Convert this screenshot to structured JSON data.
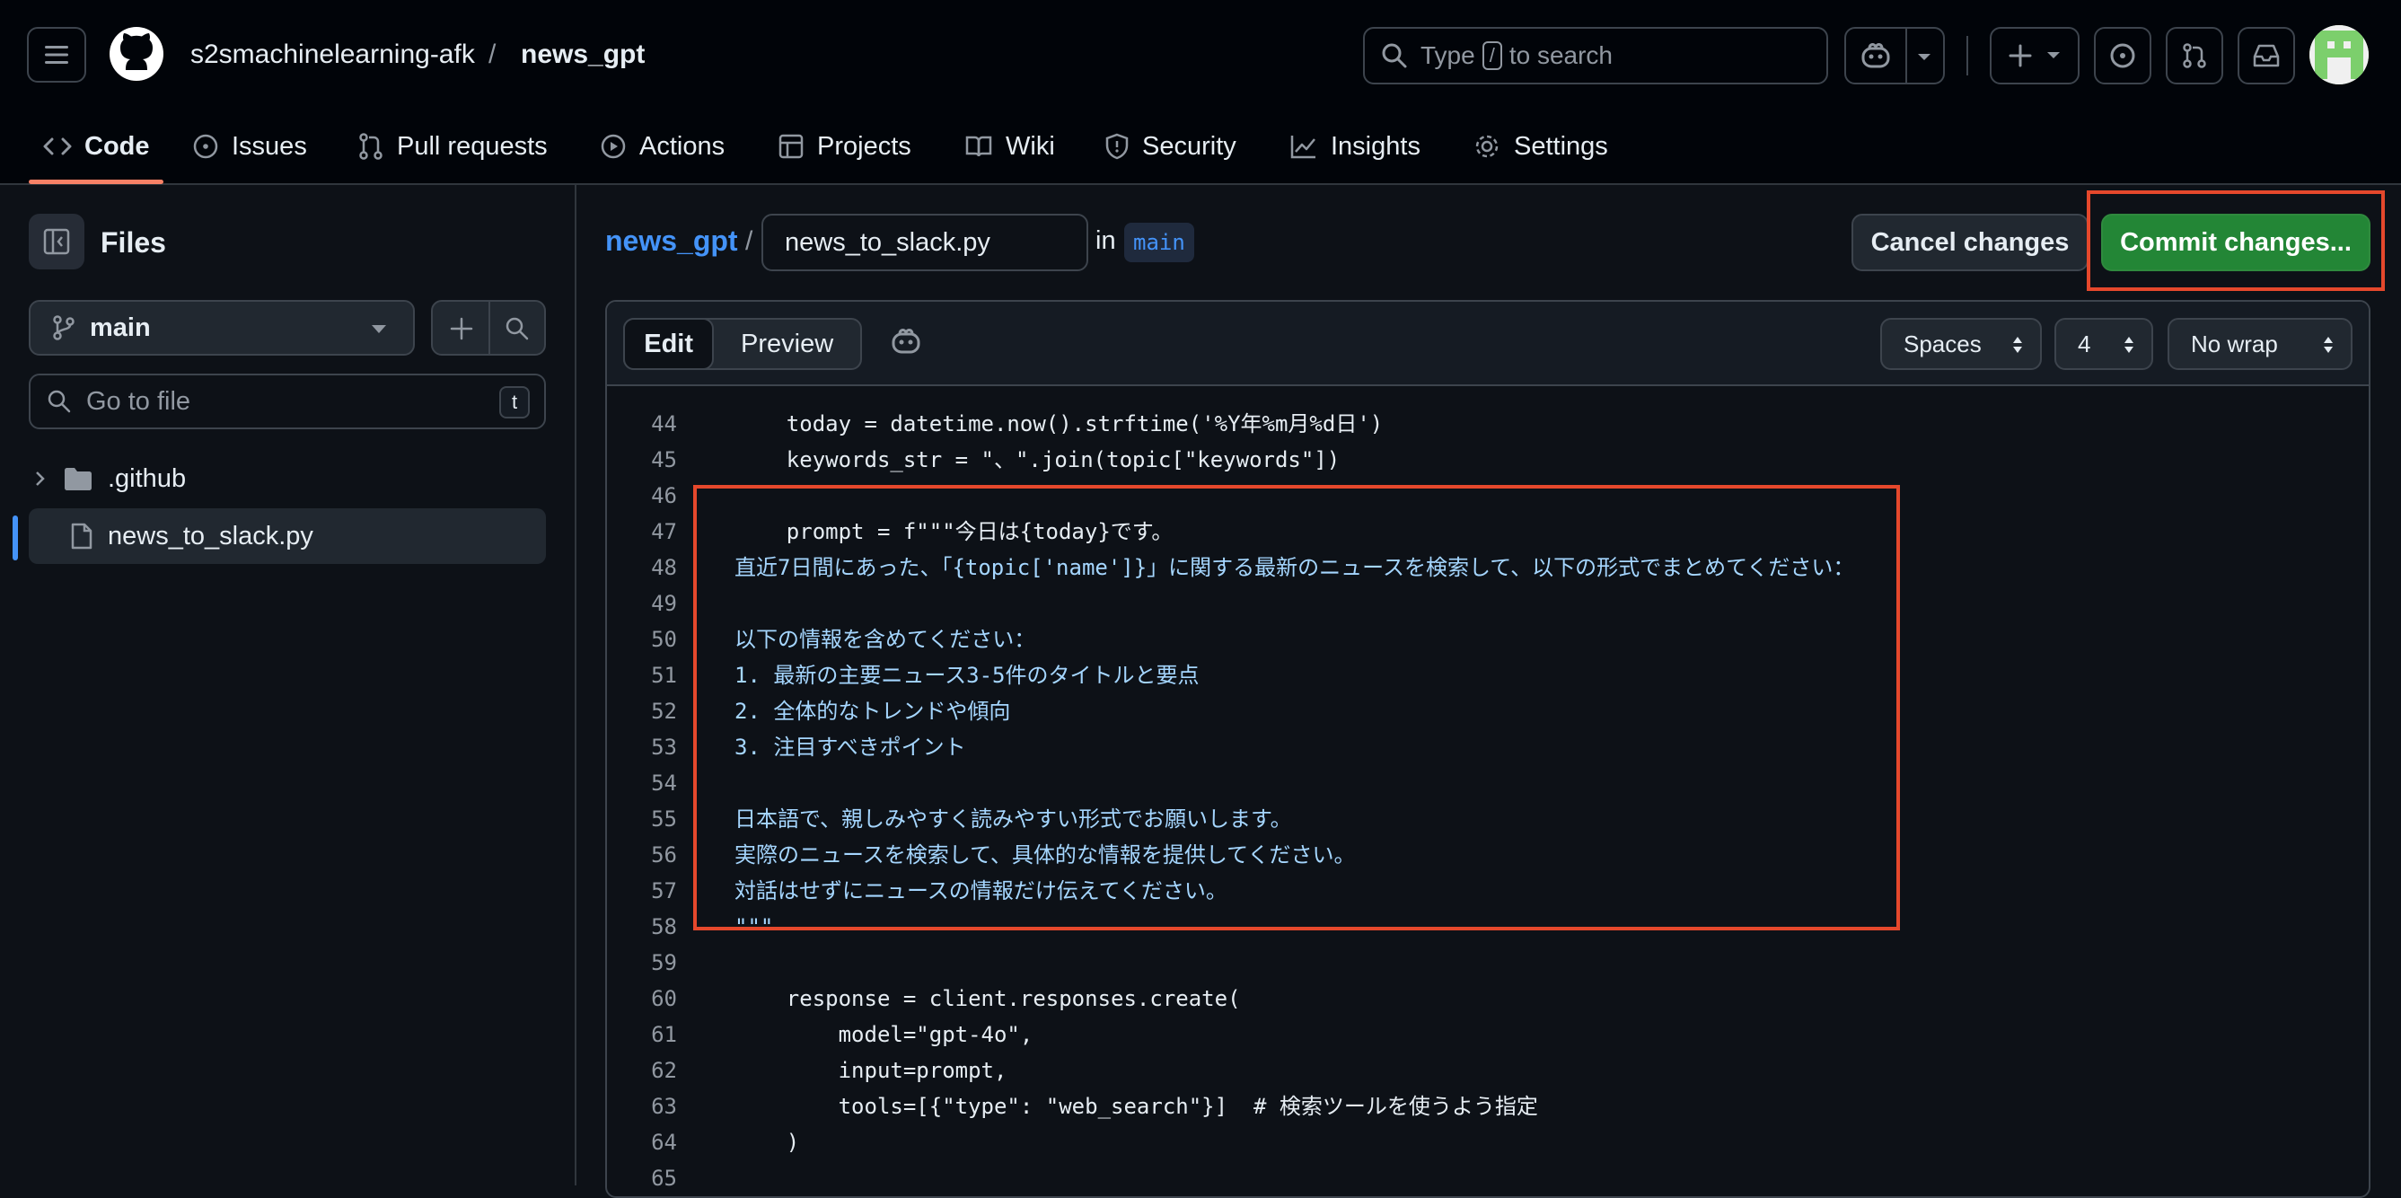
{
  "header": {
    "owner": "s2smachinelearning-afk",
    "slash": "/",
    "repo": "news_gpt",
    "search": {
      "prefix": "Type",
      "key": "/",
      "suffix": "to search"
    }
  },
  "nav": {
    "code": "Code",
    "issues": "Issues",
    "pull_requests": "Pull requests",
    "actions": "Actions",
    "projects": "Projects",
    "wiki": "Wiki",
    "security": "Security",
    "insights": "Insights",
    "settings": "Settings"
  },
  "sidebar": {
    "title": "Files",
    "branch": "main",
    "goto_placeholder": "Go to file",
    "goto_key": "t",
    "items": [
      {
        "label": ".github",
        "type": "folder"
      },
      {
        "label": "news_to_slack.py",
        "type": "file"
      }
    ]
  },
  "editor_header": {
    "repo": "news_gpt",
    "slash": "/",
    "filename": "news_to_slack.py",
    "in_label": "in",
    "branch": "main",
    "cancel_label": "Cancel changes",
    "commit_label": "Commit changes..."
  },
  "toolbar": {
    "edit_tab": "Edit",
    "preview_tab": "Preview",
    "indent_mode": "Spaces",
    "indent_size": "4",
    "wrap_mode": "No wrap"
  },
  "code_lines": [
    {
      "n": "44",
      "t": "    today = datetime.now().strftime('%Y年%m月%d日')"
    },
    {
      "n": "45",
      "t": "    keywords_str = \"、\".join(topic[\"keywords\"])"
    },
    {
      "n": "46",
      "t": ""
    },
    {
      "n": "47",
      "t": "    prompt = f\"\"\"今日は{today}です。"
    },
    {
      "n": "48",
      "t": "直近7日間にあった、「{topic['name']}」に関する最新のニュースを検索して、以下の形式でまとめてください："
    },
    {
      "n": "49",
      "t": ""
    },
    {
      "n": "50",
      "t": "以下の情報を含めてください："
    },
    {
      "n": "51",
      "t": "1. 最新の主要ニュース3-5件のタイトルと要点"
    },
    {
      "n": "52",
      "t": "2. 全体的なトレンドや傾向"
    },
    {
      "n": "53",
      "t": "3. 注目すべきポイント"
    },
    {
      "n": "54",
      "t": ""
    },
    {
      "n": "55",
      "t": "日本語で、親しみやすく読みやすい形式でお願いします。"
    },
    {
      "n": "56",
      "t": "実際のニュースを検索して、具体的な情報を提供してください。"
    },
    {
      "n": "57",
      "t": "対話はせずにニュースの情報だけ伝えてください。"
    },
    {
      "n": "58",
      "t": "\"\"\""
    },
    {
      "n": "59",
      "t": ""
    },
    {
      "n": "60",
      "t": "    response = client.responses.create("
    },
    {
      "n": "61",
      "t": "        model=\"gpt-4o\","
    },
    {
      "n": "62",
      "t": "        input=prompt,"
    },
    {
      "n": "63",
      "t": "        tools=[{\"type\": \"web_search\"}]  # 検索ツールを使うよう指定"
    },
    {
      "n": "64",
      "t": "    )"
    },
    {
      "n": "65",
      "t": ""
    }
  ],
  "colors": {
    "bg": "#0d1117",
    "header_bg": "#010409",
    "accent_blue": "#4493f8",
    "commit_green": "#238636",
    "highlight_red": "#e5482c"
  }
}
